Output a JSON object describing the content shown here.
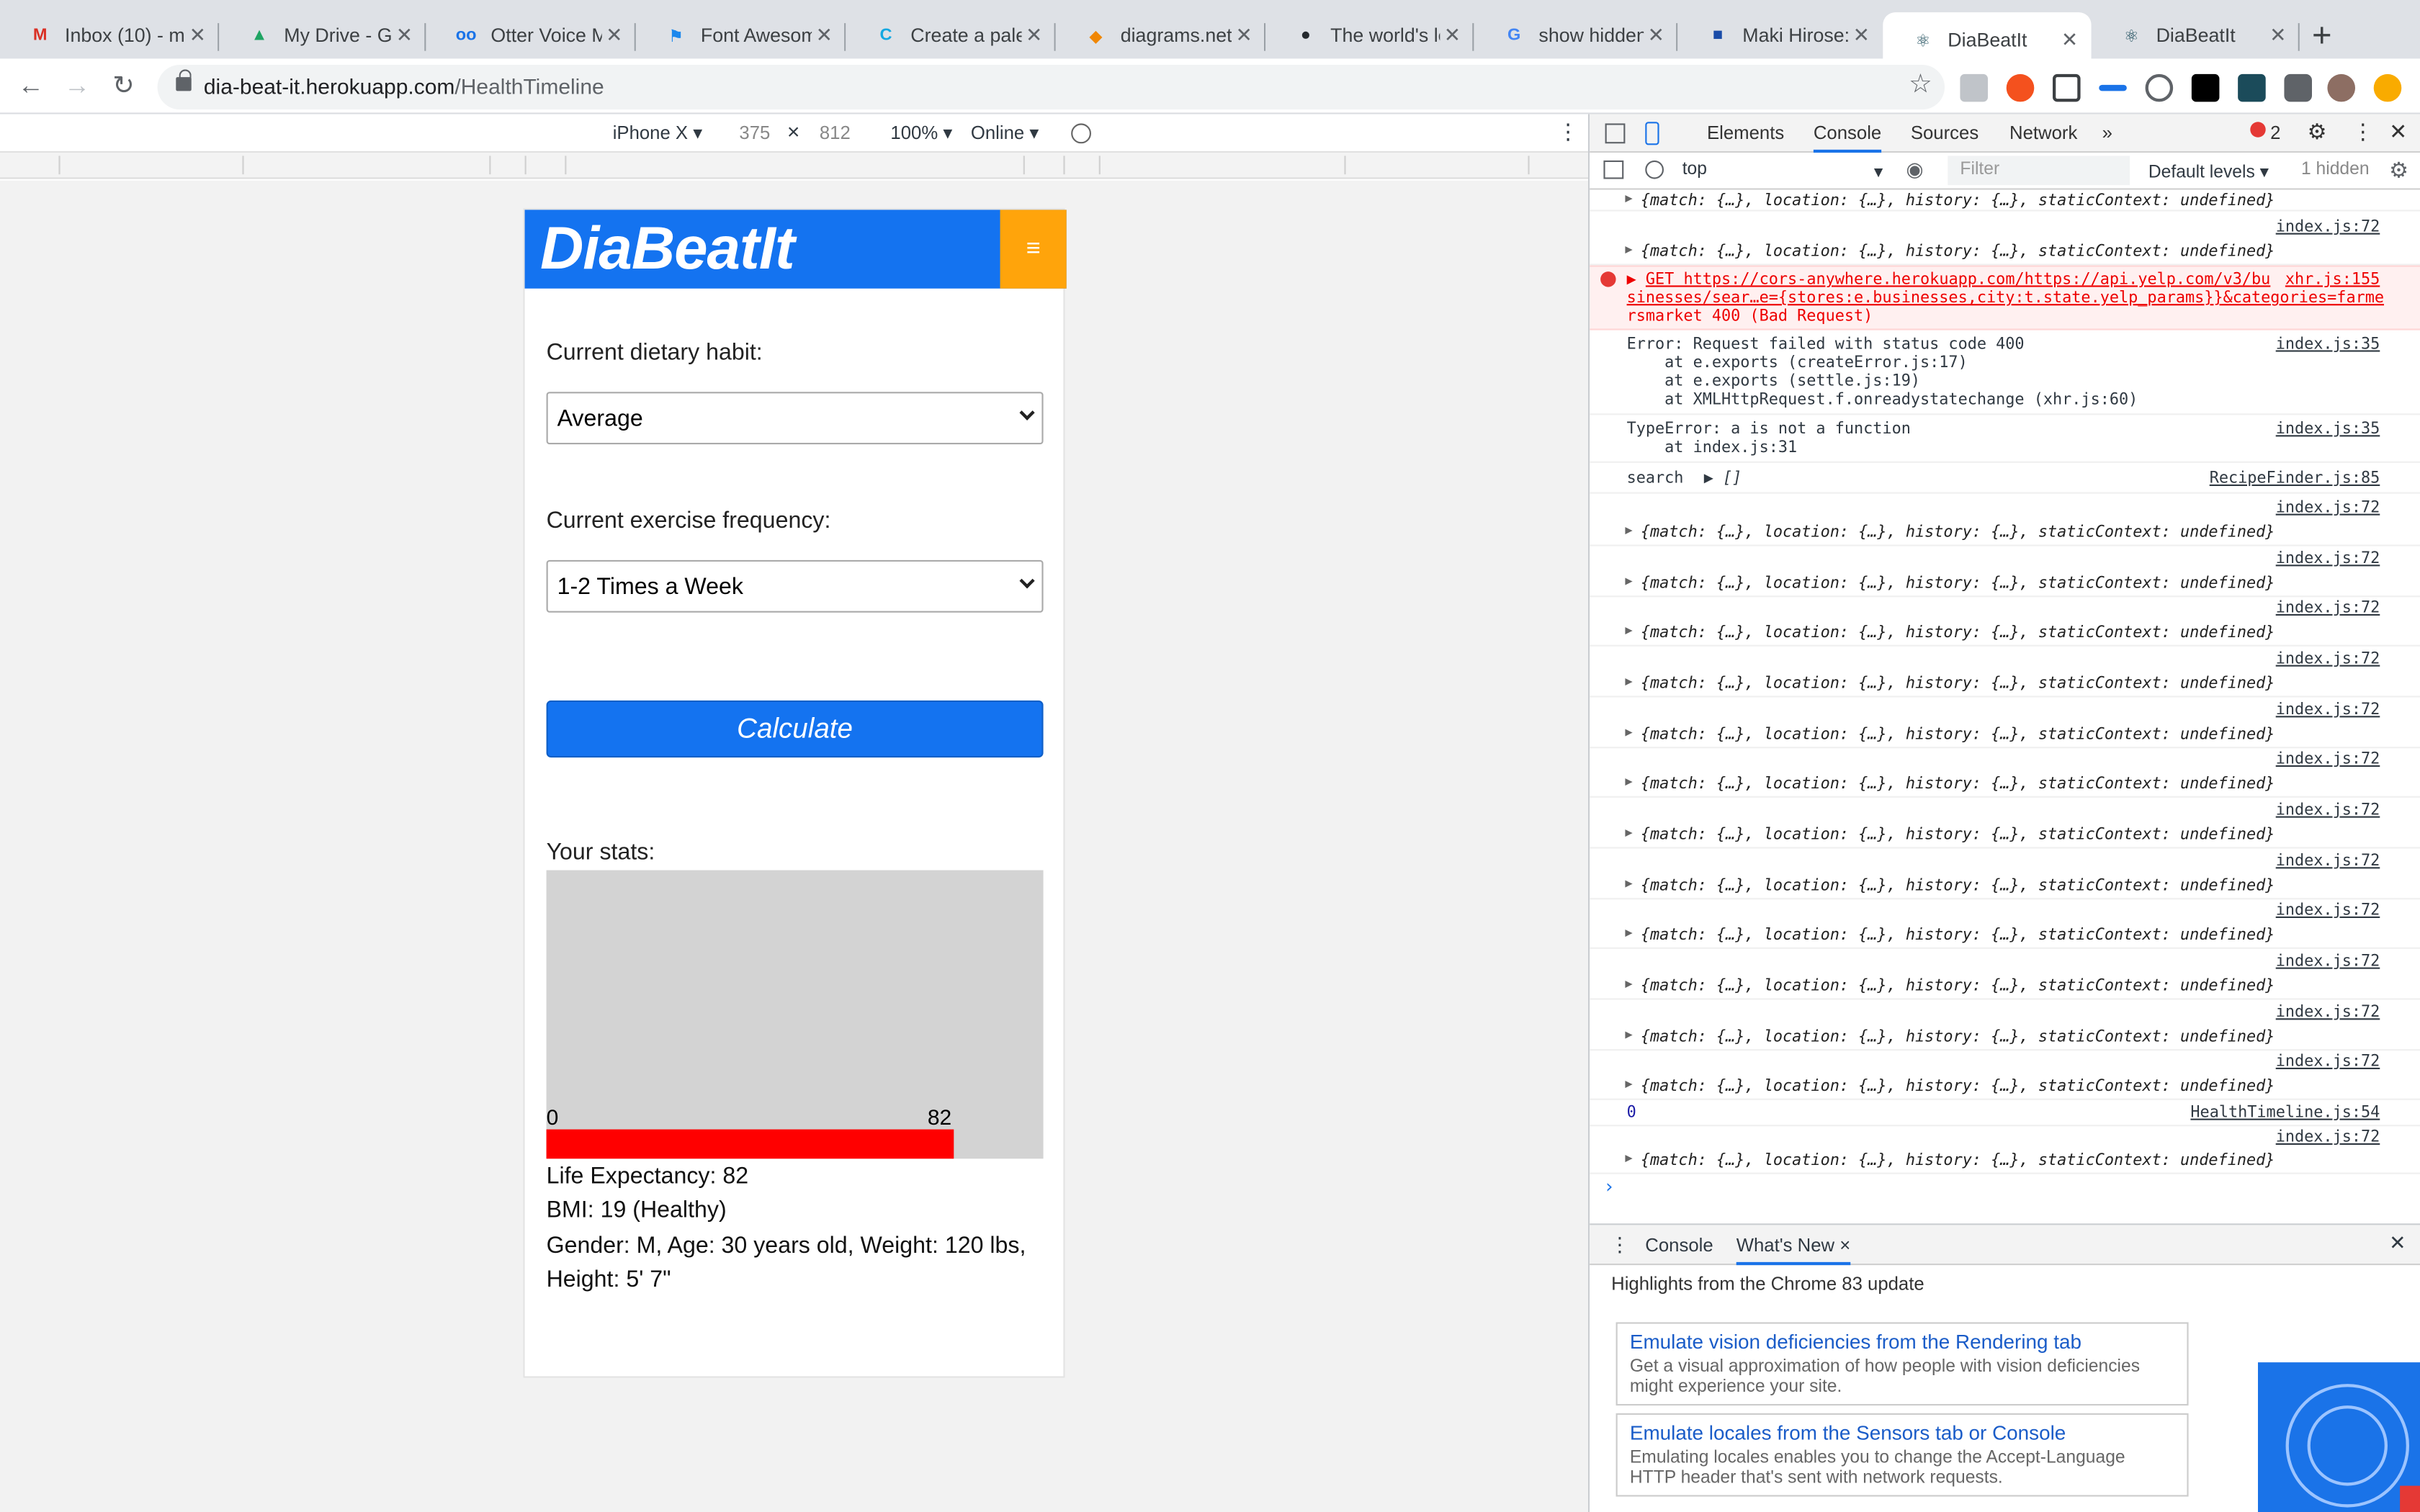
{
  "browser": {
    "tabs": [
      {
        "title": "Inbox (10) - m",
        "icon": "gmail-icon",
        "color": "#d93025",
        "glyph": "M"
      },
      {
        "title": "My Drive - Go",
        "icon": "google-drive-icon",
        "color": "#1fa463",
        "glyph": "▲"
      },
      {
        "title": "Otter Voice M",
        "icon": "otter-icon",
        "color": "#1a73e8",
        "glyph": "oo"
      },
      {
        "title": "Font Awesome",
        "icon": "font-awesome-flag-icon",
        "color": "#1c88ed",
        "glyph": "⚑"
      },
      {
        "title": "Create a palet",
        "icon": "canva-icon",
        "color": "#14a8e1",
        "glyph": "C"
      },
      {
        "title": "diagrams.net",
        "icon": "diagrams-icon",
        "color": "#f08705",
        "glyph": "◆"
      },
      {
        "title": "The world's le",
        "icon": "github-icon",
        "color": "#24292e",
        "glyph": "●"
      },
      {
        "title": "show hidden f",
        "icon": "google-icon",
        "color": "#4285f4",
        "glyph": "G"
      },
      {
        "title": "Maki Hirose: L",
        "icon": "bookmark-icon",
        "color": "#1a4ca8",
        "glyph": "■"
      },
      {
        "title": "DiaBeatIt",
        "icon": "react-icon",
        "color": "#1b4b5a",
        "glyph": "⚛"
      },
      {
        "title": "DiaBeatIt",
        "icon": "react-icon",
        "color": "#1b4b5a",
        "glyph": "⚛"
      }
    ],
    "url_host": "dia-beat-it.herokuapp.com",
    "url_path": "/HealthTimeline"
  },
  "device_toolbar": {
    "device": "iPhone X ▾",
    "width": "375",
    "times": "×",
    "height": "812",
    "zoom": "100% ▾",
    "network": "Online ▾"
  },
  "app": {
    "brand": "DiaBeatIt",
    "menu_glyph": "≡",
    "diet_label": "Current dietary habit:",
    "diet_value": "Average",
    "exercise_label": "Current exercise frequency:",
    "exercise_value": "1-2 Times a Week",
    "calculate_label": "Calculate",
    "stats_label": "Your stats:",
    "chart_data": {
      "type": "bar",
      "categories": [
        "Life Expectancy"
      ],
      "values": [
        82
      ],
      "xlim": [
        0,
        100
      ],
      "tick_labels": [
        "0",
        "82"
      ],
      "bar_color": "#ff0000",
      "background": "#d3d3d3"
    },
    "life_expectancy": "Life Expectancy: 82",
    "bmi": "BMI: 19 (Healthy)",
    "details_line1": "Gender: M, Age: 30 years old, Weight: 120 lbs,",
    "details_line2": "Height: 5' 7\""
  },
  "devtools": {
    "tabs": [
      "Elements",
      "Console",
      "Sources",
      "Network",
      "»"
    ],
    "active_tab": "Console",
    "error_count": "2",
    "context": "top",
    "filter_placeholder": "Filter",
    "levels": "Default levels ▾",
    "hidden": "1 hidden",
    "obj_text": "{match: {…}, location: {…}, history: {…}, staticContext: undefined}",
    "index72": "index.js:72",
    "err_get_line1": "GET https://cors-anywhere.herokuapp.com/https://api.yelp.com/v3/bu",
    "err_get_src": "xhr.js:155",
    "err_get_line2": "sinesses/sear…e={stores:e.businesses,city:t.state.yelp_params}}&categories=farme",
    "err_get_line3": "rsmarket 400 (Bad Request)",
    "err1_line1": "Error: Request failed with status code 400",
    "err1_line2": "    at e.exports (createError.js:17)",
    "err1_line3": "    at e.exports (settle.js:19)",
    "err1_line4": "    at XMLHttpRequest.f.onreadystatechange (xhr.js:60)",
    "err1_src": "index.js:35",
    "err2_line1": "TypeError: a is not a function",
    "err2_line2": "    at index.js:31",
    "err2_src": "index.js:35",
    "search_text": "search",
    "search_arr": "▶ []",
    "search_src": "RecipeFinder.js:85",
    "zero": "0",
    "zero_src": "HealthTimeline.js:54",
    "prompt": "›"
  },
  "drawer": {
    "tabs": [
      "Console",
      "What's New ×"
    ],
    "highlight": "Highlights from the Chrome 83 update",
    "card1_title": "Emulate vision deficiencies from the Rendering tab",
    "card1_text": "Get a visual approximation of how people with vision deficiencies might experience your site.",
    "card2_title": "Emulate locales from the Sensors tab or Console",
    "card2_text": "Emulating locales enables you to change the Accept-Language HTTP header that's sent with network requests."
  }
}
